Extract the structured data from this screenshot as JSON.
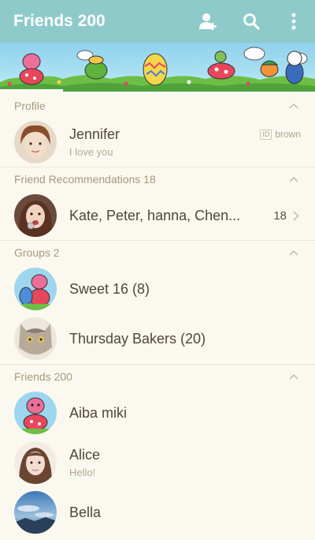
{
  "header": {
    "title": "Friends 200",
    "icons": [
      "add-friend-icon",
      "search-icon",
      "more-vertical-icon"
    ],
    "background_color": "#8ecac9"
  },
  "sections": {
    "profile": {
      "title": "Profile"
    },
    "recommendations": {
      "title": "Friend Recommendations 18"
    },
    "groups": {
      "title": "Groups 2"
    },
    "friends": {
      "title": "Friends 200"
    }
  },
  "profile": {
    "name": "Jennifer",
    "status": "I love you",
    "id_label": "ID",
    "id_value": "brown"
  },
  "recommendations": {
    "names": "Kate, Peter, hanna, Chen...",
    "count": "18"
  },
  "groups": [
    {
      "name": "Sweet 16 (8)"
    },
    {
      "name": "Thursday Bakers (20)"
    }
  ],
  "friends": [
    {
      "name": "Aiba miki",
      "status": ""
    },
    {
      "name": "Alice",
      "status": "Hello!"
    },
    {
      "name": "Bella",
      "status": ""
    }
  ],
  "colors": {
    "accent": "#8ecac9",
    "background": "#fbf9ef",
    "section_text": "#a5987f"
  }
}
